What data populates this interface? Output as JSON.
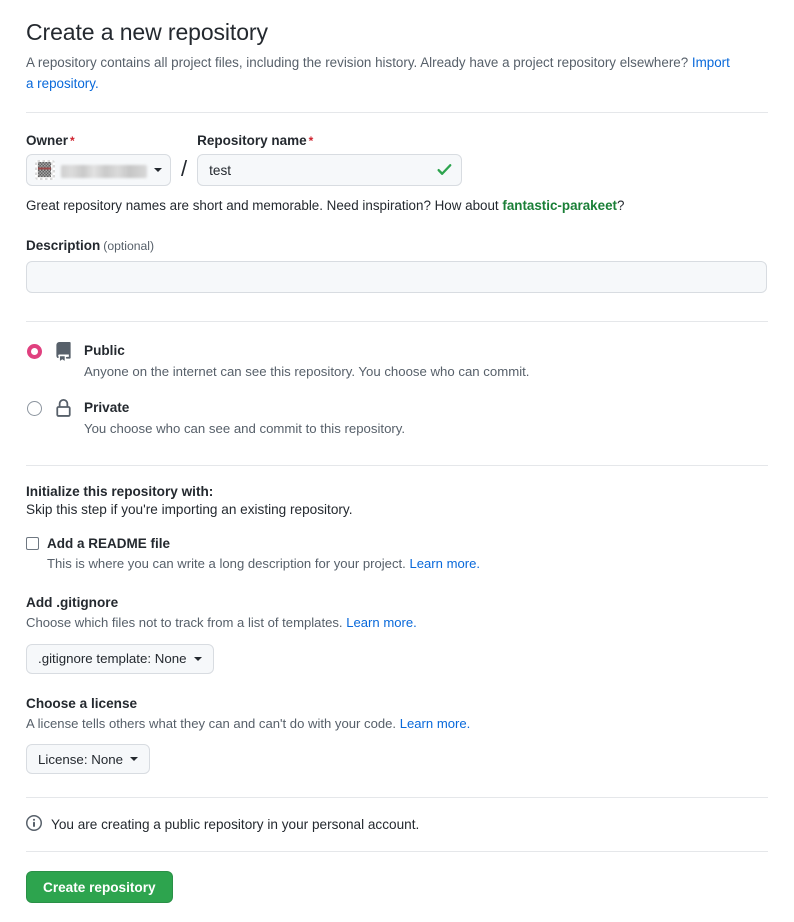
{
  "header": {
    "title": "Create a new repository",
    "subtitle_part1": "A repository contains all project files, including the revision history. Already have a project repository elsewhere? ",
    "import_link": "Import a repository.",
    "subtitle_part2": ""
  },
  "owner": {
    "label": "Owner",
    "required_mark": "*",
    "value": "",
    "redacted": true,
    "separator": "/"
  },
  "repo_name": {
    "label": "Repository name",
    "required_mark": "*",
    "value": "test",
    "placeholder": "",
    "valid_icon": "check-icon"
  },
  "name_hint": {
    "prefix": "Great repository names are short and memorable. Need inspiration? How about ",
    "suggestion": "fantastic-parakeet",
    "suffix": "?"
  },
  "description": {
    "label": "Description",
    "optional_note": "(optional)",
    "value": "",
    "placeholder": ""
  },
  "visibility": {
    "options": [
      {
        "id": "public",
        "title": "Public",
        "description": "Anyone on the internet can see this repository. You choose who can commit.",
        "icon": "repo-icon",
        "selected": true
      },
      {
        "id": "private",
        "title": "Private",
        "description": "You choose who can see and commit to this repository.",
        "icon": "lock-icon",
        "selected": false
      }
    ]
  },
  "initialize": {
    "heading": "Initialize this repository with:",
    "subheading": "Skip this step if you're importing an existing repository.",
    "readme": {
      "label": "Add a README file",
      "checked": false,
      "description": "This is where you can write a long description for your project. ",
      "learn_more": "Learn more."
    },
    "gitignore": {
      "heading": "Add .gitignore",
      "description": "Choose which files not to track from a list of templates. ",
      "learn_more": "Learn more.",
      "button_label": ".gitignore template: None"
    },
    "license": {
      "heading": "Choose a license",
      "description": "A license tells others what they can and can't do with your code. ",
      "learn_more": "Learn more.",
      "button_label": "License: None"
    }
  },
  "footer": {
    "info_icon": "info-icon",
    "info_text": "You are creating a public repository in your personal account.",
    "create_button": "Create repository"
  },
  "colors": {
    "link": "#0969da",
    "suggestion_green": "#1a7f37",
    "radio_accent": "#e0407f",
    "button_green": "#2da44e",
    "required_red": "#cf222e",
    "muted_text": "#57606a",
    "border": "#d8dce1"
  }
}
